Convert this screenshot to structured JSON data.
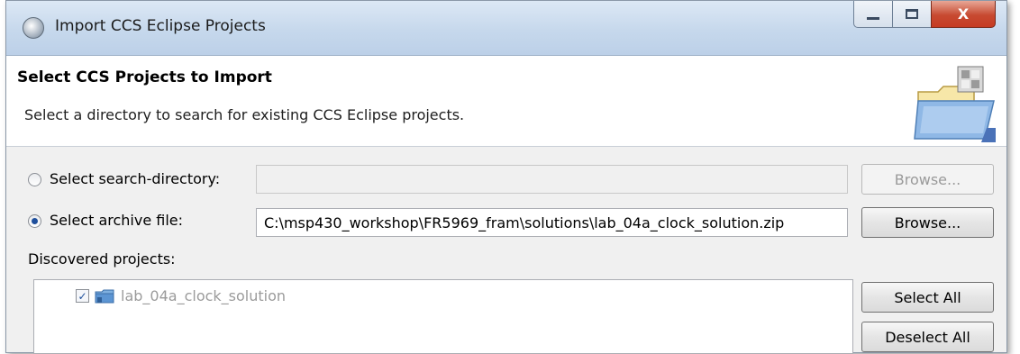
{
  "window": {
    "title": "Import CCS Eclipse Projects",
    "close_glyph": "X"
  },
  "banner": {
    "title": "Select CCS Projects to Import",
    "description": "Select a directory to search for existing CCS Eclipse projects.",
    "icon": "folder-with-cube-icon"
  },
  "source": {
    "search_directory": {
      "label": "Select search-directory:",
      "value": "",
      "selected": false,
      "browse_label": "Browse...",
      "enabled": false
    },
    "archive_file": {
      "label": "Select archive file:",
      "value": "C:\\msp430_workshop\\FR5969_fram\\solutions\\lab_04a_clock_solution.zip",
      "selected": true,
      "browse_label": "Browse...",
      "enabled": true
    }
  },
  "projects": {
    "label": "Discovered projects:",
    "items": [
      {
        "name": "lab_04a_clock_solution",
        "checked": true,
        "icon": "project-folder-icon"
      }
    ],
    "select_all_label": "Select All",
    "deselect_all_label": "Deselect All"
  },
  "colors": {
    "titlebar": "#c6d8ec",
    "close_button": "#c74a31",
    "accent": "#1f4f9c"
  }
}
